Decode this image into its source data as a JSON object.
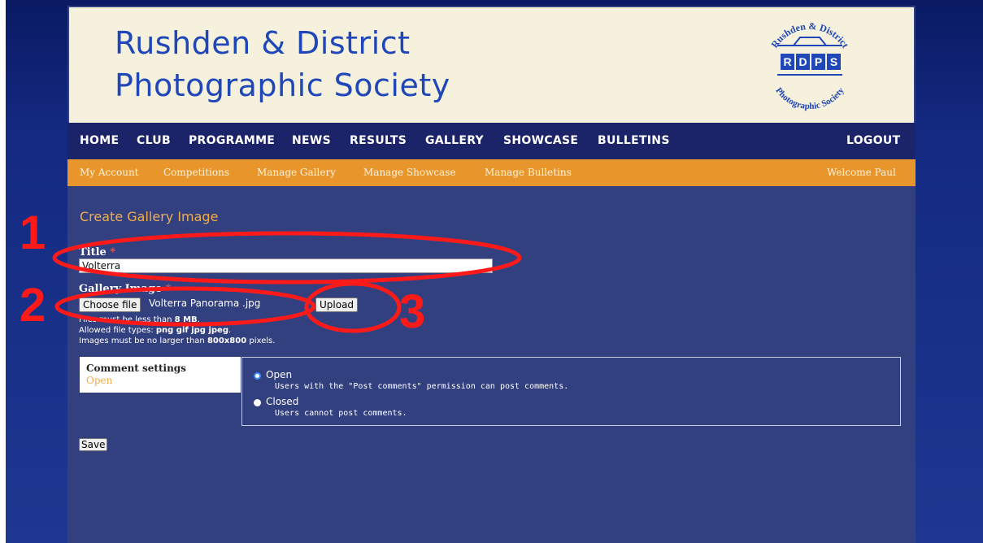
{
  "header": {
    "title_line1": "Rushden & District",
    "title_line2": "Photographic Society",
    "logo": {
      "ring_text_top": "Rushden & District",
      "ring_text_bottom": "Photographic Society",
      "letters": [
        "R",
        "D",
        "P",
        "S"
      ]
    }
  },
  "main_nav": [
    "HOME",
    "CLUB",
    "PROGRAMME",
    "NEWS",
    "RESULTS",
    "GALLERY",
    "SHOWCASE",
    "BULLETINS"
  ],
  "logout_label": "LOGOUT",
  "sub_nav": [
    "My Account",
    "Competitions",
    "Manage Gallery",
    "Manage Showcase",
    "Manage Bulletins"
  ],
  "welcome": "Welcome Paul",
  "page_title": "Create Gallery Image",
  "form": {
    "title_label": "Title",
    "title_value": "Volterra",
    "required_mark": "*",
    "image_label": "Gallery Image",
    "choose_file_label": "Choose file",
    "selected_file": "Volterra Panorama .jpg",
    "upload_label": "Upload",
    "help_size_prefix": "Files must be less than",
    "help_size_value": "8 MB",
    "help_types_prefix": "Allowed file types:",
    "help_types_value": "png gif jpg jpeg",
    "help_dims_prefix": "Images must be no larger than",
    "help_dims_value": "800x800",
    "help_dims_suffix": "pixels.",
    "comment_settings_title": "Comment settings",
    "comment_settings_summary": "Open",
    "comment_options": [
      {
        "label": "Open",
        "description": "Users with the \"Post comments\" permission can post comments.",
        "selected": true
      },
      {
        "label": "Closed",
        "description": "Users cannot post comments.",
        "selected": false
      }
    ],
    "save_label": "Save"
  },
  "annotations": [
    "1",
    "2",
    "3"
  ],
  "colors": {
    "accent_orange": "#e8962c",
    "annotation_red": "#ff1a1a",
    "page_bg": "#334080",
    "nav_bg": "#1b2468",
    "title_blue": "#1f47b8"
  }
}
